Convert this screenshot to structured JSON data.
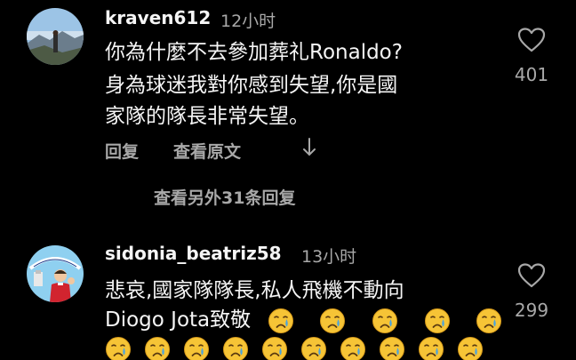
{
  "comments": [
    {
      "username": "kraven612",
      "time": "12小时",
      "lines": [
        "你為什麼不去參加葬礼Ronaldo?",
        "身為球迷我對你感到失望,你是國",
        "家隊的隊長非常失望。"
      ],
      "reply_label": "回复",
      "translate_label": "查看原文",
      "likes": "401",
      "more_replies_label": "查看另外31条回复"
    },
    {
      "username": "sidonia_beatriz58",
      "time": "13小时",
      "lines": [
        "悲哀,國家隊隊長,私人飛機不動向",
        "Diogo Jota致敬"
      ],
      "likes": "299"
    }
  ],
  "icons": {
    "heart": "heart-outline-icon",
    "arrow": "arrow-down-icon",
    "emoji": "crying-face-emoji"
  },
  "colors": {
    "background": "#000000",
    "text": "#f5f5f5",
    "muted": "#a8a8a8",
    "emoji_face": "#f6c436",
    "tear": "#4aa3df"
  }
}
